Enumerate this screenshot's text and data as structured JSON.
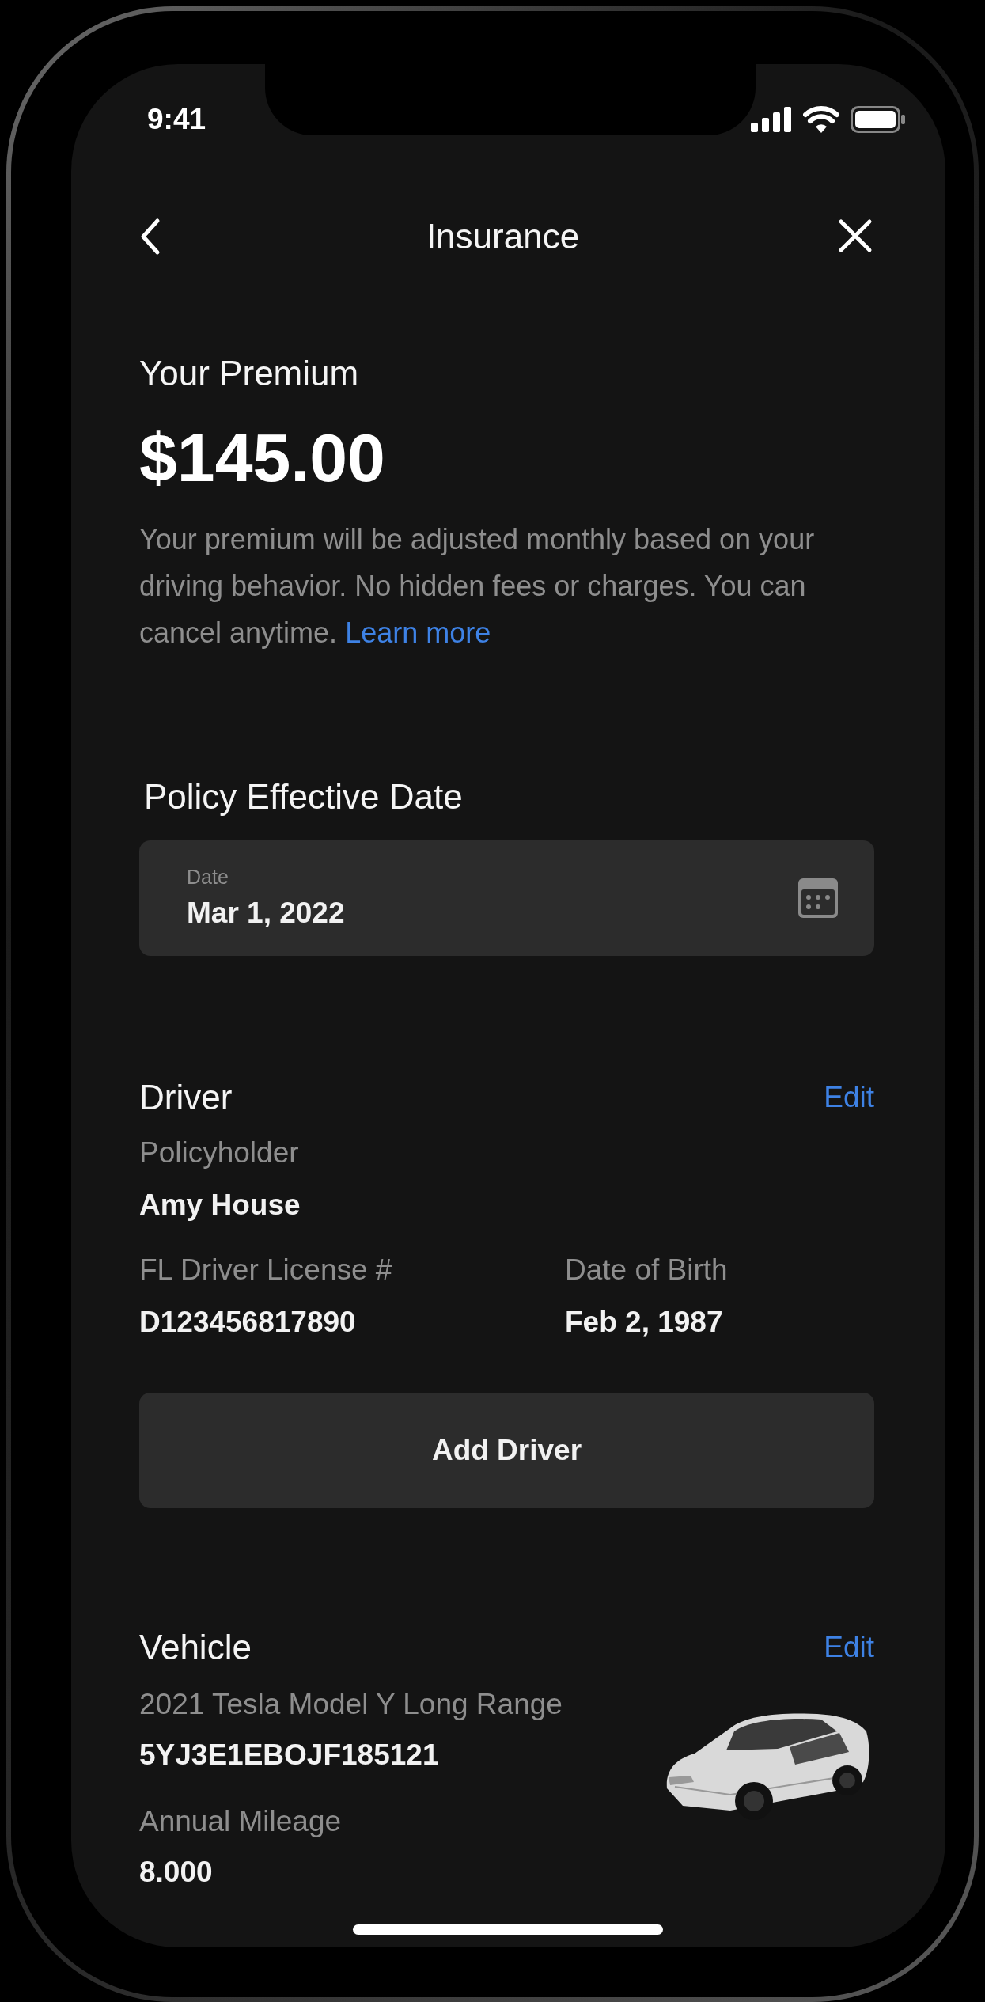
{
  "status_bar": {
    "time": "9:41"
  },
  "header": {
    "title": "Insurance"
  },
  "premium": {
    "heading": "Your Premium",
    "amount": "$145.00",
    "description": "Your premium will be adjusted monthly based on your driving behavior. No hidden fees or charges. You can cancel anytime.",
    "link": "Learn more"
  },
  "policy_date": {
    "heading": "Policy Effective Date",
    "field": {
      "label": "Date",
      "value": "Mar 1, 2022"
    }
  },
  "driver": {
    "heading": "Driver",
    "action": "Edit",
    "fields": [
      {
        "label": "Policyholder",
        "value": "Amy House"
      },
      {
        "label": "FL Driver License #",
        "value": "D123456817890"
      },
      {
        "label": "Date of Birth",
        "value": "Feb 2, 1987"
      }
    ],
    "button": "Add Driver"
  },
  "vehicle": {
    "heading": "Vehicle",
    "action": "Edit",
    "model": "2021 Tesla Model Y Long Range",
    "vin": "5YJ3E1EBOJF185121",
    "fields": [
      {
        "label": "Annual Mileage",
        "value": "8.000"
      }
    ]
  }
}
